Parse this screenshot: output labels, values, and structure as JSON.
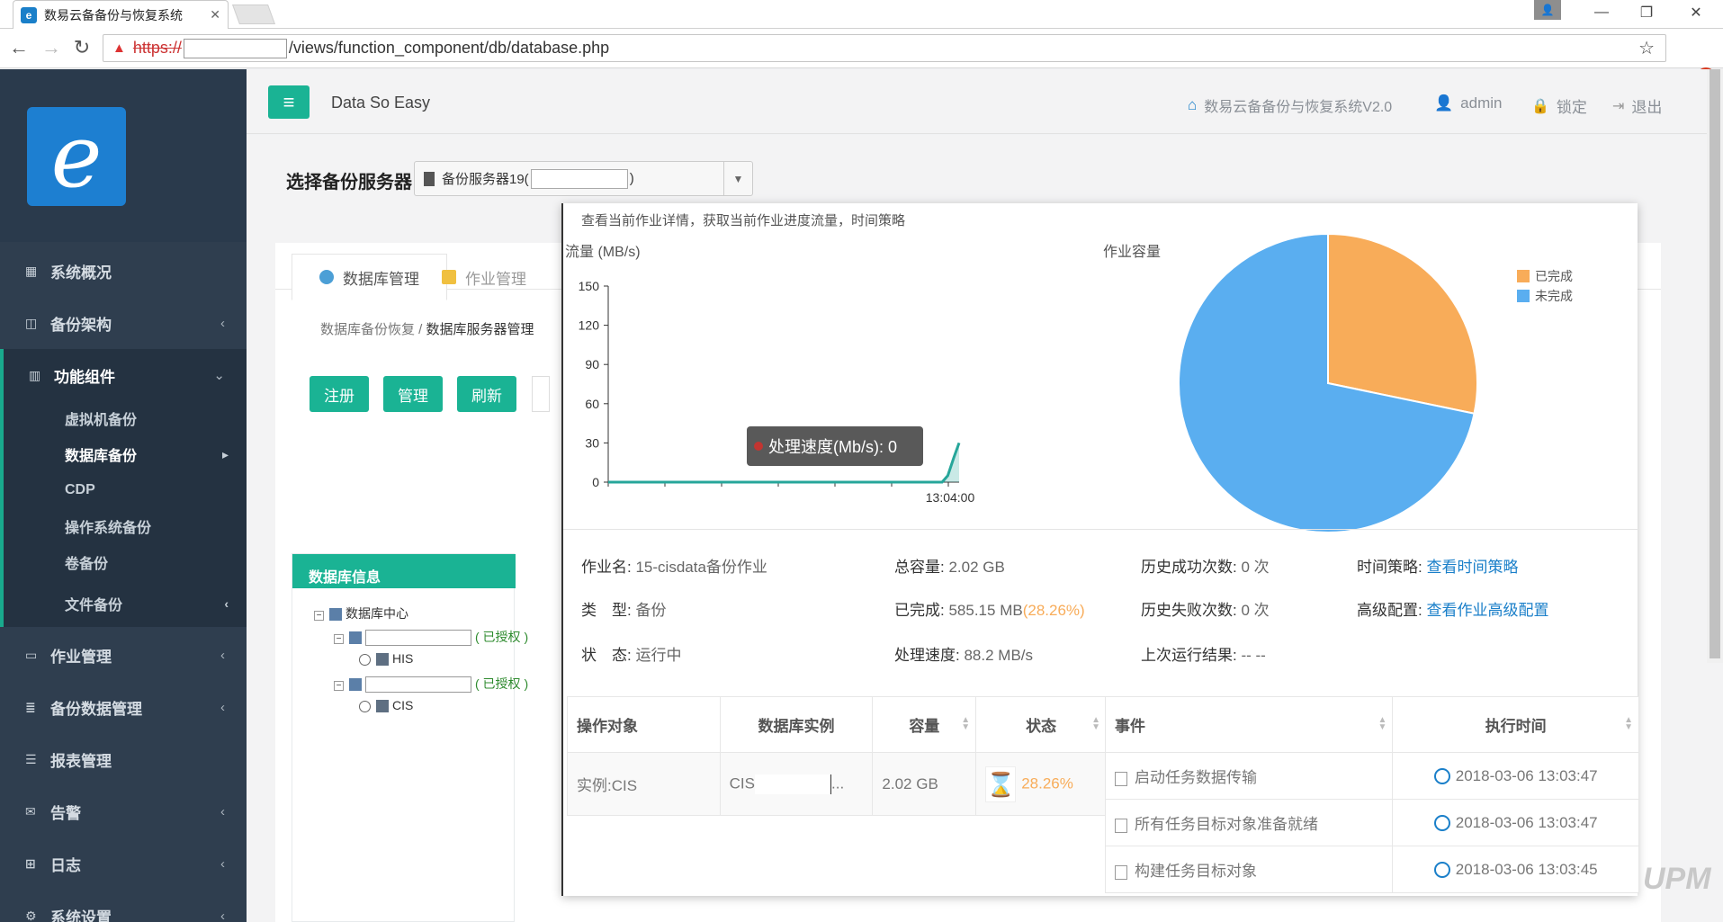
{
  "browser": {
    "tab_title": "数易云备备份与恢复系统",
    "url_scheme": "https://",
    "url_path": "/views/function_component/db/database.php"
  },
  "sidebar": {
    "nav": [
      {
        "label": "系统概况",
        "icon": "grid-icon"
      },
      {
        "label": "备份架构",
        "icon": "columns-icon"
      },
      {
        "label": "功能组件",
        "icon": "chart-icon"
      },
      {
        "label": "作业管理",
        "icon": "monitor-icon"
      },
      {
        "label": "备份数据管理",
        "icon": "database-icon"
      },
      {
        "label": "报表管理",
        "icon": "list-icon"
      },
      {
        "label": "告警",
        "icon": "envelope-icon"
      },
      {
        "label": "日志",
        "icon": "table-icon"
      },
      {
        "label": "系统设置",
        "icon": "gear-icon"
      }
    ],
    "sub": [
      "虚拟机备份",
      "数据库备份",
      "CDP",
      "操作系统备份",
      "卷备份",
      "文件备份"
    ]
  },
  "header": {
    "brand": "Data So Easy",
    "system": "数易云备备份与恢复系统V2.0",
    "user": "admin",
    "lock": "锁定",
    "logout": "退出"
  },
  "content": {
    "server_label": "选择备份服务器",
    "server_value_prefix": "备份服务器19(",
    "server_value_suffix": ")",
    "tabs": [
      "数据库管理",
      "作业管理"
    ],
    "crumb_parent": "数据库备份恢复 /",
    "crumb_current": "数据库服务器管理",
    "buttons": [
      "注册",
      "管理",
      "刷新"
    ],
    "dbinfo_title": "数据库信息",
    "tree": {
      "root": "数据库中心",
      "authorized": "( 已授权 )",
      "instances": [
        "HIS",
        "CIS"
      ]
    }
  },
  "modal": {
    "desc": "查看当前作业详情，获取当前作业进度流量，时间策略",
    "tooltip_label": "处理速度(Mb/s): 0",
    "job": {
      "name_k": "作业名:",
      "name_v": "15-cisdata备份作业",
      "type_k": "类　型:",
      "type_v": "备份",
      "status_k": "状　态:",
      "status_v": "运行中",
      "total_k": "总容量:",
      "total_v": "2.02 GB",
      "done_k": "已完成:",
      "done_v": "585.15 MB",
      "done_pct": "(28.26%)",
      "speed_k": "处理速度:",
      "speed_v": "88.2 MB/s",
      "succ_k": "历史成功次数:",
      "succ_v": "0 次",
      "fail_k": "历史失败次数:",
      "fail_v": "0 次",
      "last_k": "上次运行结果:",
      "last_v": "-- --",
      "policy_k": "时间策略:",
      "policy_v": "查看时间策略",
      "adv_k": "高级配置:",
      "adv_v": "查看作业高级配置"
    },
    "table1": {
      "headers": [
        "操作对象",
        "数据库实例",
        "容量",
        "状态"
      ],
      "row": {
        "object": "实例:CIS",
        "instance": "CIS",
        "ellipsis": "...",
        "size": "2.02 GB",
        "pct": "28.26%"
      }
    },
    "table2": {
      "headers": [
        "事件",
        "执行时间"
      ],
      "rows": [
        {
          "event": "启动任务数据传输",
          "time": "2018-03-06 13:03:47"
        },
        {
          "event": "所有任务目标对象准备就绪",
          "time": "2018-03-06 13:03:47"
        },
        {
          "event": "构建任务目标对象",
          "time": "2018-03-06 13:03:45"
        }
      ]
    }
  },
  "chart_data": [
    {
      "type": "line",
      "title": "流量 (MB/s)",
      "ylim": [
        0,
        150
      ],
      "yticks": [
        0,
        30,
        60,
        90,
        120,
        150
      ],
      "xtick_label": "13:04:00",
      "series": [
        {
          "values": [
            0,
            0,
            0,
            0,
            0,
            0,
            0,
            0,
            0,
            0,
            0,
            0,
            0,
            0,
            0,
            0,
            0,
            0,
            0,
            0,
            0,
            0,
            0,
            0,
            0,
            0,
            0,
            0,
            0,
            0,
            0,
            0,
            0,
            0,
            0,
            0,
            0,
            0,
            0,
            0,
            0,
            0,
            0,
            0,
            0,
            0,
            0,
            0,
            0,
            0,
            0,
            0,
            0,
            0,
            0,
            0,
            0,
            0,
            0,
            0,
            5,
            18,
            30
          ]
        }
      ],
      "color": "#26a69a",
      "grid": false
    },
    {
      "type": "pie",
      "title": "作业容量",
      "slices": [
        {
          "label": "已完成",
          "value": 28.26,
          "color": "#f8ac59"
        },
        {
          "label": "未完成",
          "value": 71.74,
          "color": "#5aaef0"
        }
      ],
      "legend": "top-right"
    }
  ],
  "watermark": "UPM"
}
